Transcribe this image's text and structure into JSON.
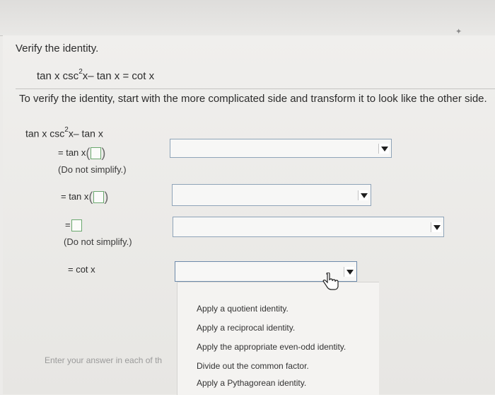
{
  "prompt": "Verify the identity.",
  "given": {
    "left_a": "tan x csc",
    "exp": "2",
    "left_b": "x– tan x",
    "equals": "=",
    "right": "cot x"
  },
  "instruction": "To verify the identity, start with the more complicated side and transform it to look like the other side.",
  "start_expr": {
    "a": "tan x csc",
    "exp": "2",
    "b": "x– tan x"
  },
  "steps": [
    {
      "label": "= tan x",
      "note": "(Do not simplify.)"
    },
    {
      "label": "= tan x",
      "note": ""
    },
    {
      "label": "=",
      "note": "(Do not simplify.)"
    },
    {
      "label": "= cot x",
      "note": ""
    }
  ],
  "menu_options": [
    "Apply a quotient identity.",
    "Apply a reciprocal identity.",
    "Apply the appropriate even-odd identity.",
    "Divide out the common factor.",
    "Apply a Pythagorean identity."
  ],
  "hint": "Enter your answer in each of th"
}
